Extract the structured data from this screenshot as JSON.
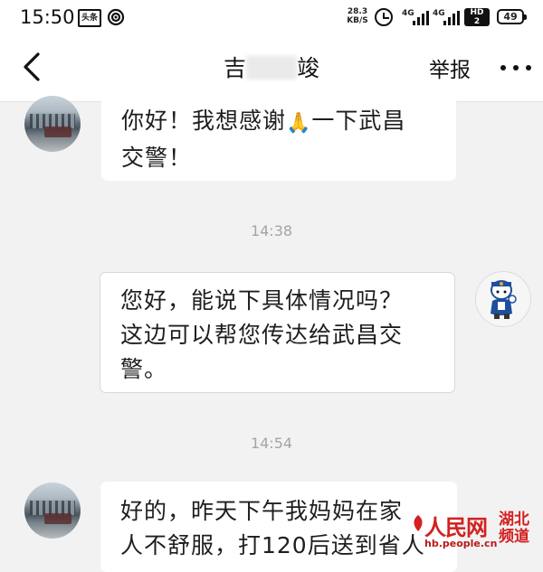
{
  "status_bar": {
    "time": "15:50",
    "badge_text": "头条",
    "net_speed_value": "28.3",
    "net_speed_unit": "KB/S",
    "signal_1_label": "4G",
    "signal_2_label": "4G",
    "hd_label": "HD",
    "hd_sub": "2",
    "battery": "49"
  },
  "header": {
    "title_prefix": "吉",
    "title_suffix": "竣",
    "report_label": "举报",
    "back_icon": "chevron-left-icon",
    "more_icon": "more-dots-icon"
  },
  "messages": [
    {
      "direction": "incoming",
      "lines": [
        "你好！我想感谢",
        "一下武昌",
        "交警！"
      ],
      "emoji": "🙏"
    },
    {
      "timestamp": "14:38"
    },
    {
      "direction": "outgoing",
      "lines": [
        "您好，能说下具体情况吗？",
        "这边可以帮您传达给武昌交",
        "警。"
      ]
    },
    {
      "timestamp": "14:54"
    },
    {
      "direction": "incoming",
      "lines": [
        "好的，昨天下午我妈妈在家",
        "人不舒服，打120后送到省人"
      ]
    }
  ],
  "watermark": {
    "logo": "人民网",
    "region_line1": "湖北",
    "region_line2": "频道",
    "url": "hb.people.cn"
  },
  "colors": {
    "background": "#f2f2f2",
    "bubble": "#ffffff",
    "timestamp": "#a4a4a4",
    "watermark_red": "#d42020"
  }
}
